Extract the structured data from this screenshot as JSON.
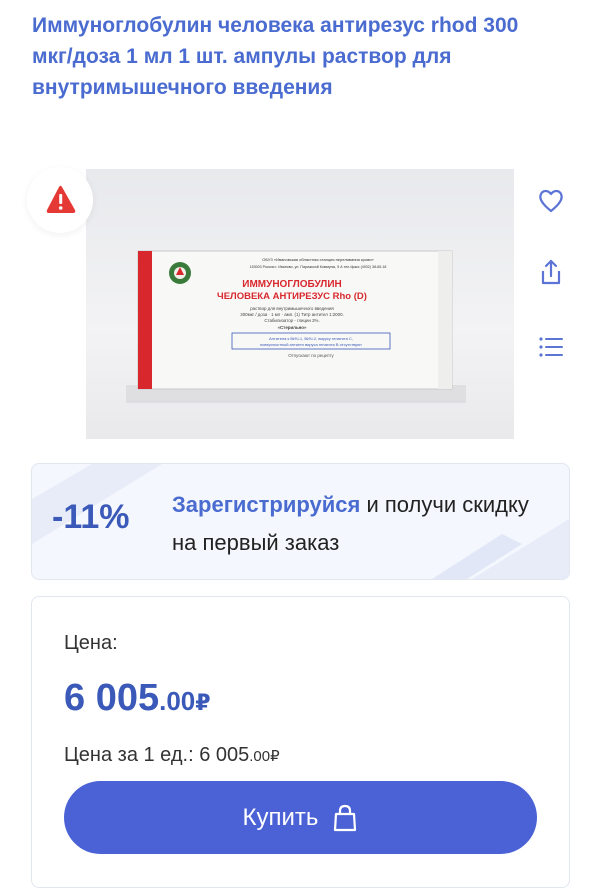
{
  "product": {
    "title": "Иммуноглобулин человека антирезус rhod 300 мкг/доза 1 мл 1 шт. ампулы раствор для внутримышечного введения"
  },
  "image": {
    "box_header_line1": "ОБУЗ «Ивановская областная станция переливания крови»",
    "box_header_line2": "153003 Россия г. Иваново, ул. Парижской Коммуны, 5 А тел./факс (4932) 38-65-18",
    "box_title_line1": "ИММУНОГЛОБУЛИН",
    "box_title_line2": "ЧЕЛОВЕКА АНТИРЕЗУС Rho (D)",
    "box_desc_line1": "раствор для внутримышечного введения",
    "box_desc_line2": "300мкг / доза · 1 мл · амп. (1) Титр антител 1:2000.",
    "box_desc_line3": "Стабилизатор - глицин 2%.",
    "box_desc_line4": "«Стерильно»",
    "box_note_line1": "Антитела к ВИЧ-1, ВИЧ-2, вирусу гепатита С,",
    "box_note_line2": "поверхностный антиген вируса гепатита В отсутствуют",
    "box_footer": "Отпускают по рецепту"
  },
  "icons": {
    "warning": "warning-icon",
    "favorite": "heart-icon",
    "share": "share-icon",
    "list": "list-icon",
    "bag": "shopping-bag-icon"
  },
  "promo": {
    "discount": "-11%",
    "link_text": "Зарегистрируйся",
    "rest_text": " и получи скидку на первый заказ"
  },
  "price": {
    "label": "Цена:",
    "integer": "6 005",
    "decimal": ".00",
    "currency": "₽",
    "unit_label": "Цена за 1 ед.: 6 005",
    "unit_decimal": ".00",
    "unit_currency": "₽"
  },
  "buy_button": {
    "label": "Купить"
  },
  "colors": {
    "accent": "#4a6bd0",
    "button": "#4a62d6",
    "warning": "#e53935",
    "box_red": "#d8282e"
  }
}
